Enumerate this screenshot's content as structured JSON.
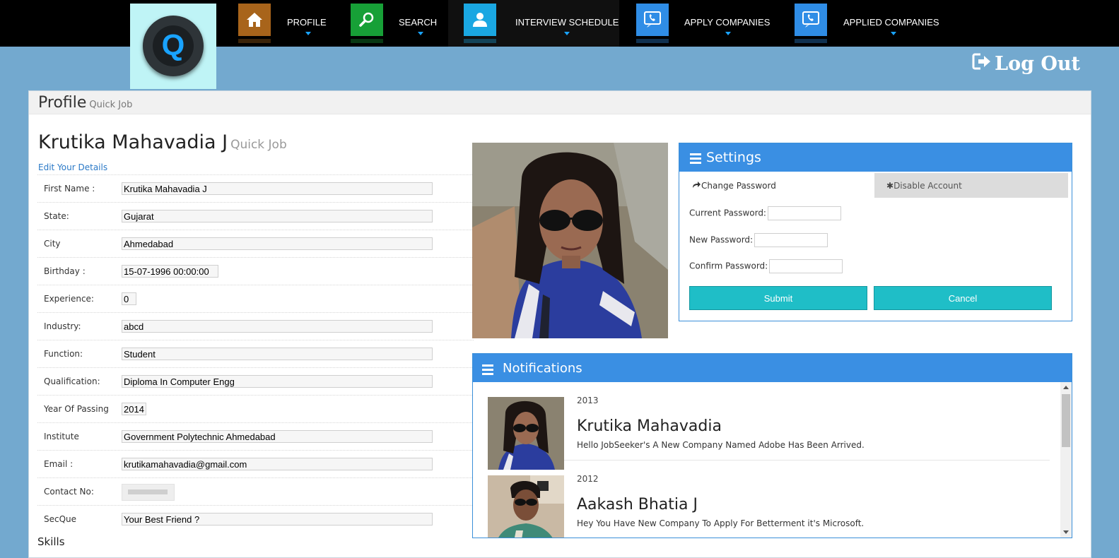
{
  "nav": {
    "items": [
      {
        "label": "PROFILE",
        "icon": "home-icon",
        "color": "#a8641b"
      },
      {
        "label": "SEARCH",
        "icon": "search-icon",
        "color": "#17a037"
      },
      {
        "label": "INTERVIEW SCHEDULE",
        "icon": "user-icon",
        "color": "#1aa7e2"
      },
      {
        "label": "APPLY COMPANIES",
        "icon": "phone-icon",
        "color": "#2f8de6"
      },
      {
        "label": "APPLIED COMPANIES",
        "icon": "phone-icon",
        "color": "#2f8de6"
      }
    ],
    "logo_letter": "Q",
    "logout_label": "Log Out"
  },
  "profile": {
    "header_title": "Profile",
    "header_subtitle": "Quick Job",
    "name": "Krutika Mahavadia J",
    "name_subtitle": "Quick Job",
    "edit_link": "Edit Your Details",
    "fields": [
      {
        "label": "First Name :",
        "value": "Krutika Mahavadia J"
      },
      {
        "label": "State:",
        "value": "Gujarat"
      },
      {
        "label": "City",
        "value": "Ahmedabad"
      },
      {
        "label": "Birthday :",
        "value": "15-07-1996 00:00:00"
      },
      {
        "label": "Experience:",
        "value": "0"
      },
      {
        "label": "Industry:",
        "value": "abcd"
      },
      {
        "label": "Function:",
        "value": "Student"
      },
      {
        "label": "Qualification:",
        "value": "Diploma In Computer Engg"
      },
      {
        "label": "Year Of Passing",
        "value": "2014"
      },
      {
        "label": "Institute",
        "value": "Government Polytechnic Ahmedabad"
      },
      {
        "label": "Email :",
        "value": "krutikamahavadia@gmail.com"
      },
      {
        "label": "Contact No:",
        "value": ""
      },
      {
        "label": "SecQue",
        "value": "Your Best Friend ?"
      }
    ],
    "skills_heading": "Skills"
  },
  "settings": {
    "title": "Settings",
    "tab_change": "Change Password",
    "tab_disable": "Disable Account",
    "current_label": "Current Password:",
    "new_label": "New Password:",
    "confirm_label": "Confirm Password:",
    "submit": "Submit",
    "cancel": "Cancel"
  },
  "notifications": {
    "title": "Notifications",
    "items": [
      {
        "year": "2013",
        "name": "Krutika Mahavadia",
        "message": "Hello JobSeeker's A New Company Named Adobe Has Been Arrived."
      },
      {
        "year": "2012",
        "name": "Aakash Bhatia J",
        "message": "Hey You Have New Company To Apply For Betterment it's Microsoft."
      }
    ]
  }
}
